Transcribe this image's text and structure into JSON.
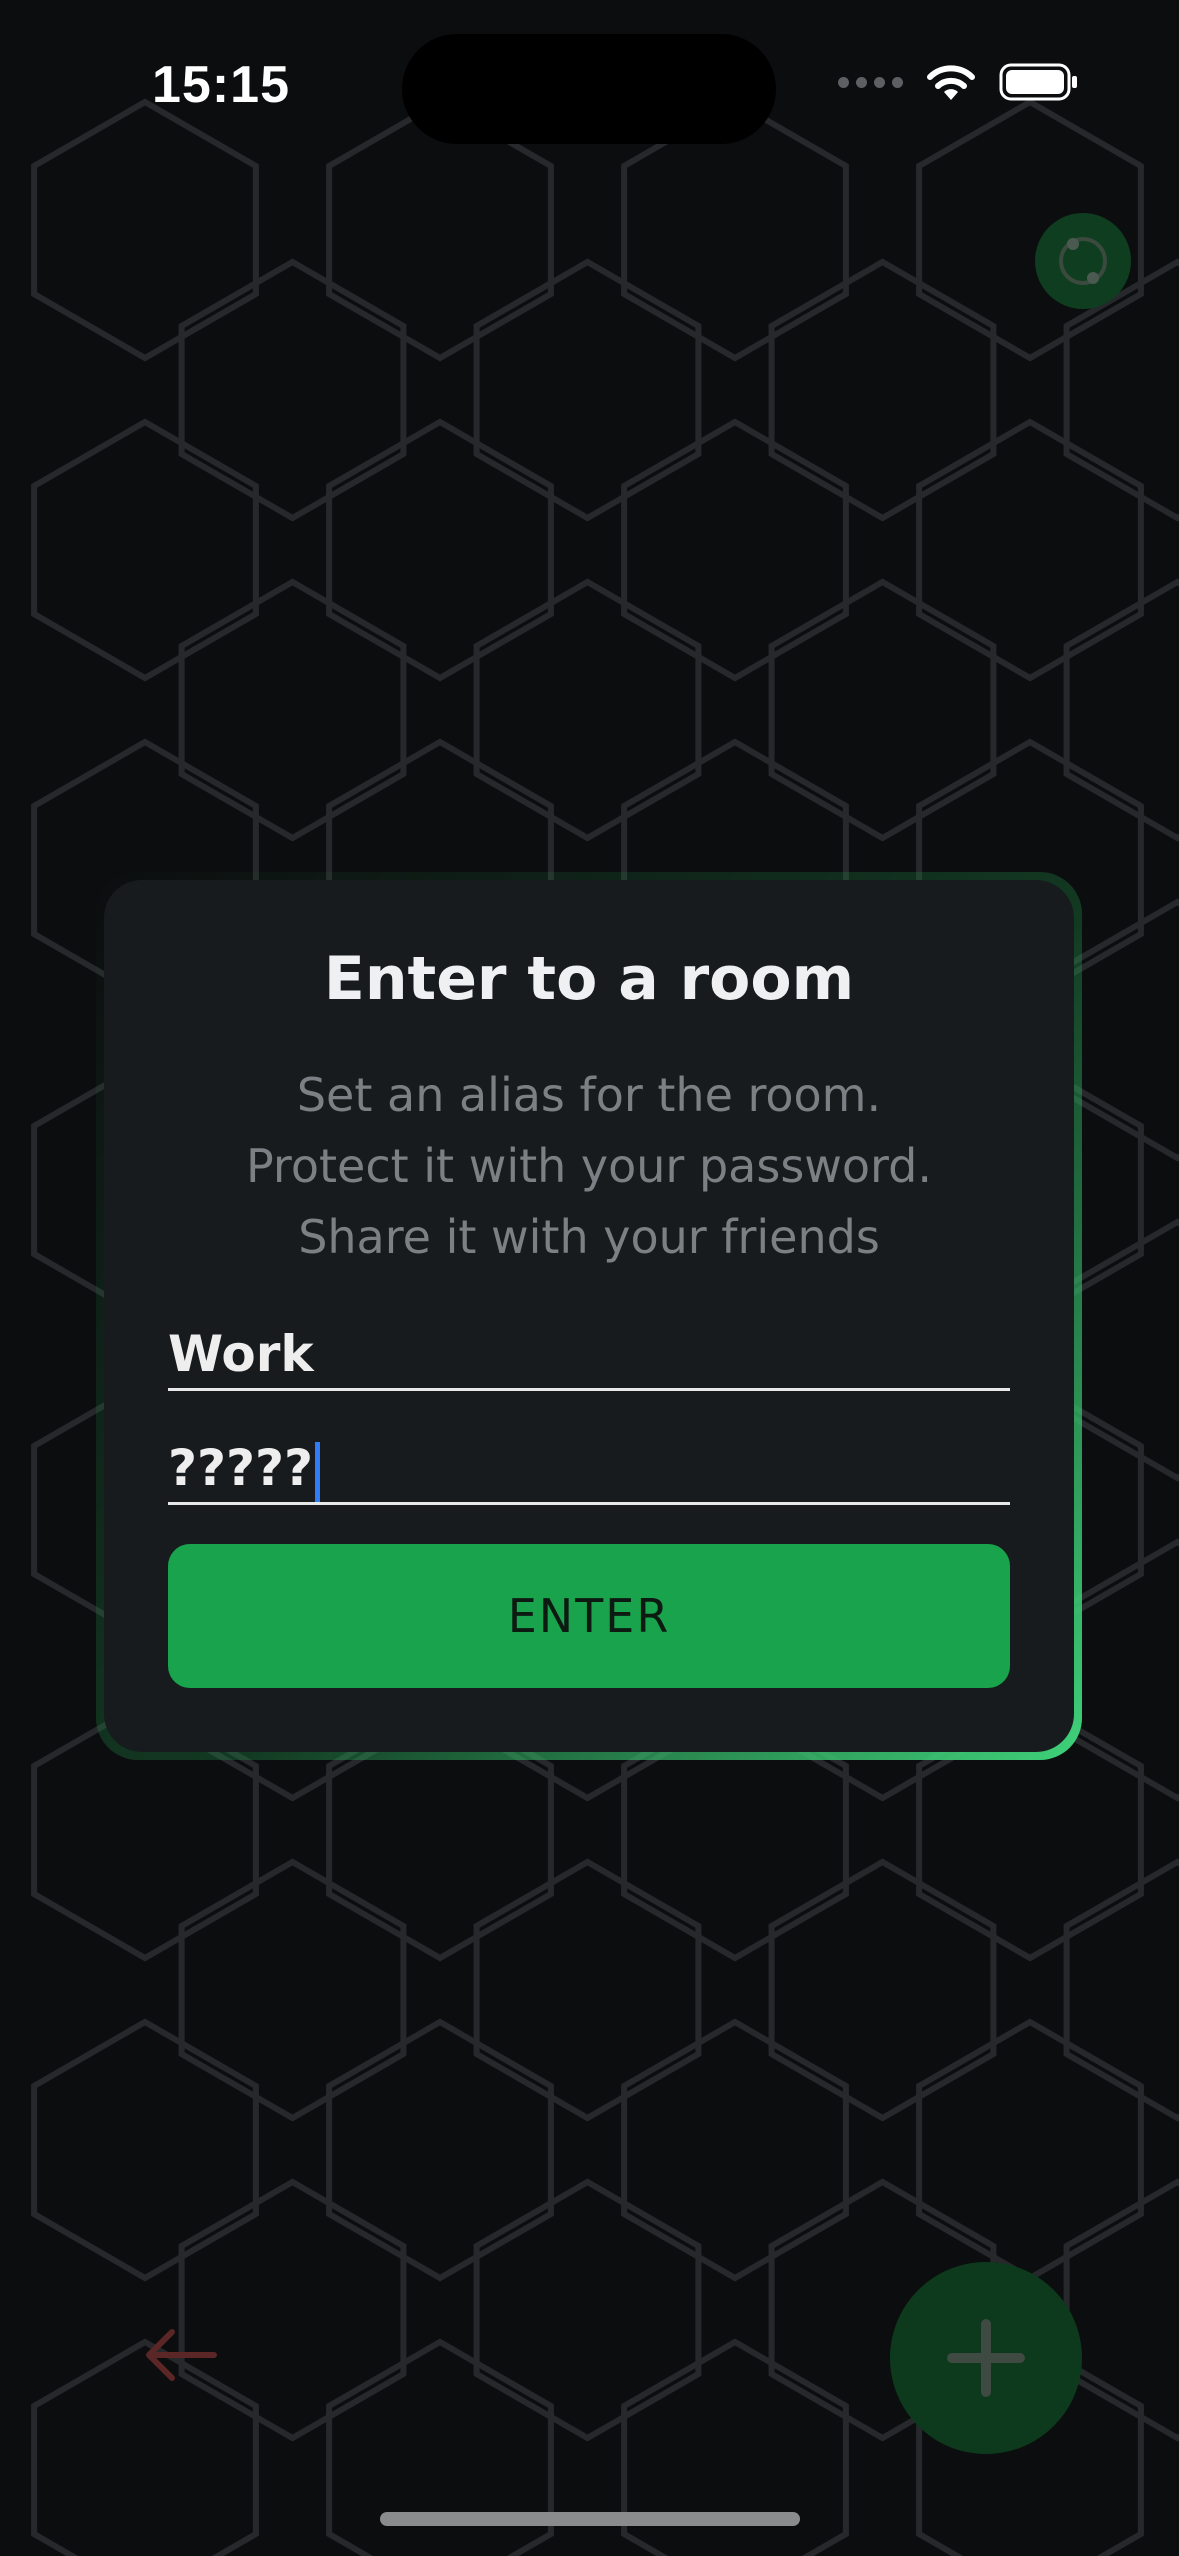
{
  "status_bar": {
    "time": "15:15"
  },
  "dialog": {
    "title": "Enter to a room",
    "description_lines": [
      "Set an alias for the room.",
      "Protect it with your password.",
      "Share it with your friends"
    ],
    "alias_value": "Work",
    "password_value": "?????",
    "enter_label": "ENTER"
  },
  "icons": {
    "sync": "sync-icon",
    "back": "arrow-left-icon",
    "add": "plus-icon"
  },
  "colors": {
    "background": "#0c0d0f",
    "dialog": "#181b1d",
    "accent": "#19a34c",
    "glow": "#3fd27a",
    "back_arrow": "#5a2626"
  }
}
